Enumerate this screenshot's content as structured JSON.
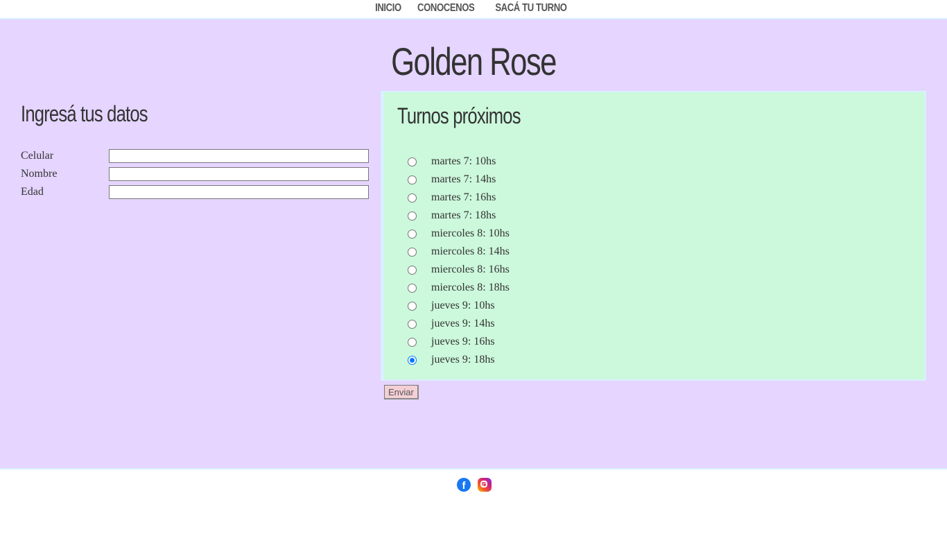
{
  "nav": {
    "items": [
      "INICIO",
      "CONOCENOS",
      "SACÁ TU TURNO"
    ]
  },
  "site": {
    "title": "Golden Rose"
  },
  "form": {
    "title": "Ingresá tus datos",
    "fields": [
      {
        "label": "Celular",
        "value": ""
      },
      {
        "label": "Nombre",
        "value": ""
      },
      {
        "label": "Edad",
        "value": ""
      }
    ]
  },
  "slots": {
    "title": "Turnos próximos",
    "items": [
      {
        "label": "martes 7: 10hs",
        "checked": false
      },
      {
        "label": "martes 7: 14hs",
        "checked": false
      },
      {
        "label": "martes 7: 16hs",
        "checked": false
      },
      {
        "label": "martes 7: 18hs",
        "checked": false
      },
      {
        "label": "miercoles 8: 10hs",
        "checked": false
      },
      {
        "label": "miercoles 8: 14hs",
        "checked": false
      },
      {
        "label": "miercoles 8: 16hs",
        "checked": false
      },
      {
        "label": "miercoles 8: 18hs",
        "checked": false
      },
      {
        "label": "jueves 9: 10hs",
        "checked": false
      },
      {
        "label": "jueves 9: 14hs",
        "checked": false
      },
      {
        "label": "jueves 9: 16hs",
        "checked": false
      },
      {
        "label": "jueves 9: 18hs",
        "checked": true
      }
    ]
  },
  "submit": {
    "label": "Enviar"
  },
  "footer": {
    "icons": [
      "facebook-icon",
      "instagram-icon"
    ]
  },
  "colors": {
    "main_bg": "#e5d5ff",
    "panel_bg": "#ccf8dc",
    "button_bg": "#f4cfd6",
    "radio_checked": "#0075ff"
  }
}
